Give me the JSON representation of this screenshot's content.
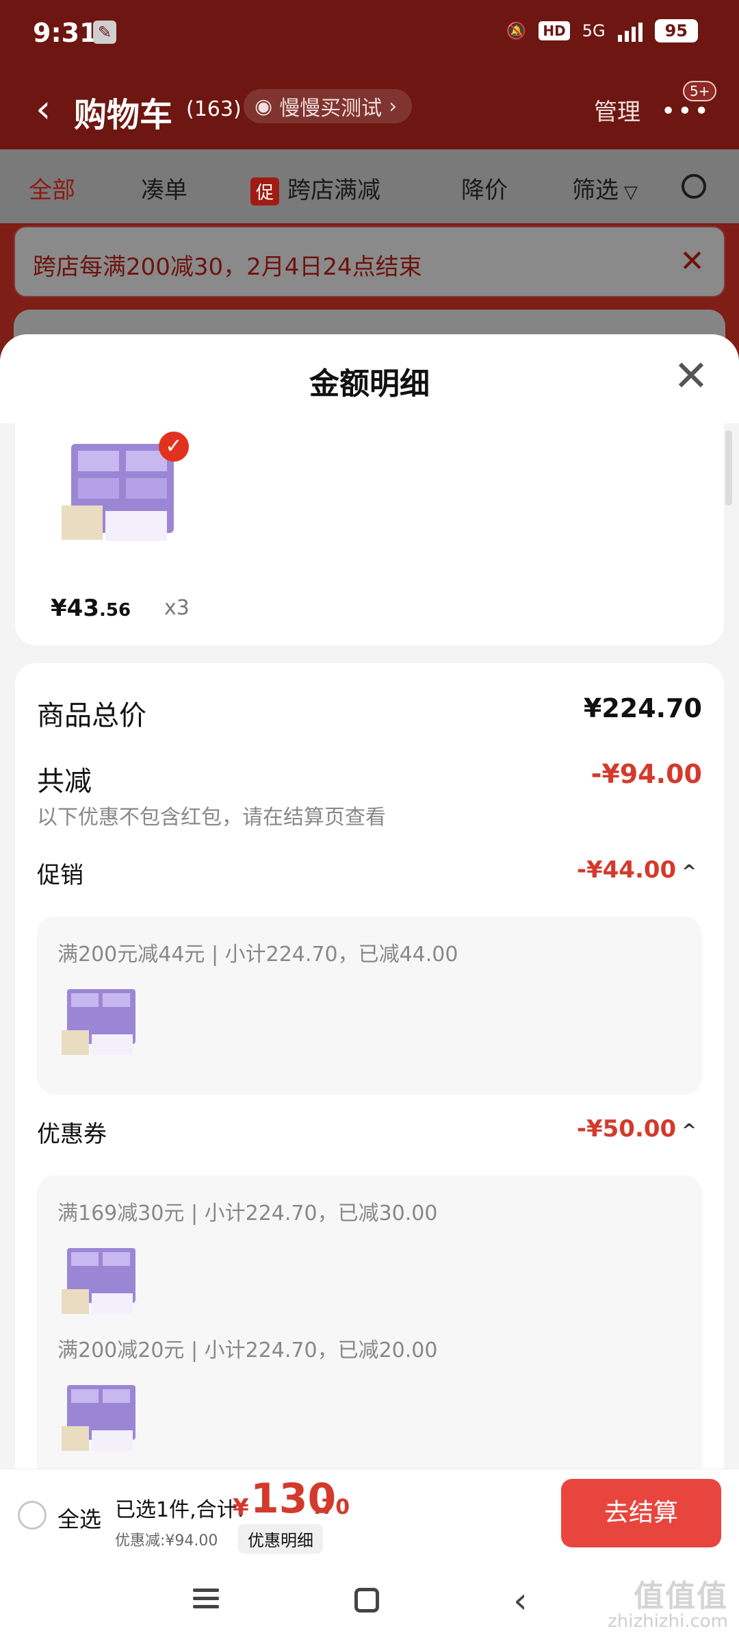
{
  "status_bar": {
    "time": "9:31",
    "network": "5G",
    "hd": "HD",
    "battery": "95"
  },
  "header": {
    "title": "购物车",
    "count": "(163)",
    "test_label": "慢慢买测试",
    "test_chevron": "›",
    "manage": "管理",
    "more_badge": "5+"
  },
  "filters": [
    {
      "label": "全部",
      "active": true
    },
    {
      "label": "凑单"
    },
    {
      "label": "跨店满减",
      "badge": "促"
    },
    {
      "label": "降价"
    },
    {
      "label": "筛选"
    }
  ],
  "notice": {
    "text": "跨店每满200减30，2月4日24点结束",
    "close": "✕"
  },
  "sheet": {
    "title": "金额明细",
    "close": "✕",
    "product": {
      "price_int": "¥43",
      "price_dec": ".56",
      "qty": "x3"
    },
    "total_label": "商品总价",
    "total_value": "¥224.70",
    "reduce_label": "共减",
    "reduce_value": "-¥94.00",
    "reduce_note": "以下优惠不包含红包，请在结算页查看",
    "promo_label": "促销",
    "promo_value": "-¥44.00",
    "promo_detail": "满200元减44元 | 小计224.70，已减44.00",
    "coupon_label": "优惠券",
    "coupon_value": "-¥50.00",
    "coupon_detail_1": "满169减30元 | 小计224.70，已减30.00",
    "coupon_detail_2": "满200减20元 | 小计224.70，已减20.00",
    "chevron": "^"
  },
  "bottom": {
    "select_all": "全选",
    "selected_text": "已选1件,合计:",
    "currency": "¥",
    "total_int": "130",
    "total_dec": ".70",
    "discount": "优惠减:¥94.00",
    "detail_button": "优惠明细",
    "checkout": "去结算"
  },
  "watermark": {
    "top": "值值值",
    "bottom": "zhizhizhi.com"
  },
  "colors": {
    "accent_red": "#d33a2c",
    "header_dark_red": "#6e1611",
    "checkout_red": "#e8453f"
  }
}
